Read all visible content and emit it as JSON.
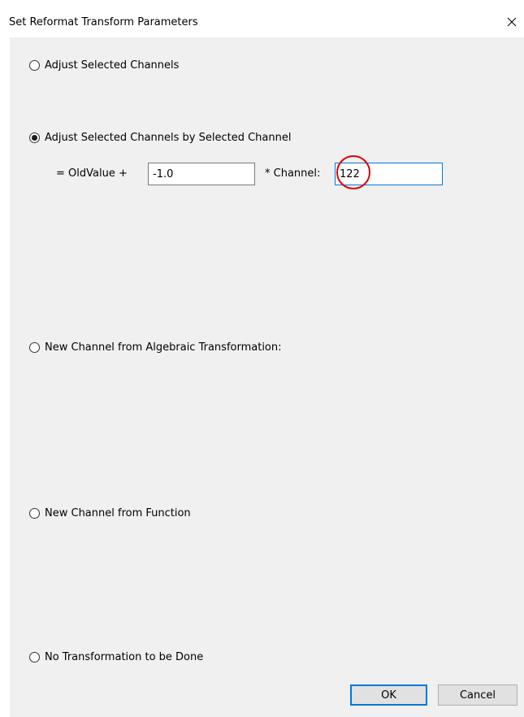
{
  "window": {
    "title": "Set Reformat Transform Parameters"
  },
  "options": {
    "adjust_selected": {
      "label": "Adjust Selected Channels",
      "selected": false
    },
    "adjust_by_channel": {
      "label": "Adjust Selected Channels by Selected Channel",
      "selected": true,
      "equation_prefix": "= OldValue +",
      "coefficient_value": "-1.0",
      "channel_label": "* Channel:",
      "channel_value": "122"
    },
    "algebraic": {
      "label": "New Channel from Algebraic Transformation:",
      "selected": false
    },
    "function": {
      "label": "New Channel from Function",
      "selected": false
    },
    "none": {
      "label": "No Transformation to be Done",
      "selected": false
    }
  },
  "buttons": {
    "ok_label": "OK",
    "cancel_label": "Cancel"
  },
  "colors": {
    "focus_border": "#0078d7",
    "annotation_circle": "#e00000",
    "client_background": "#f0f0f0"
  },
  "icons": {
    "close": "close-icon"
  }
}
